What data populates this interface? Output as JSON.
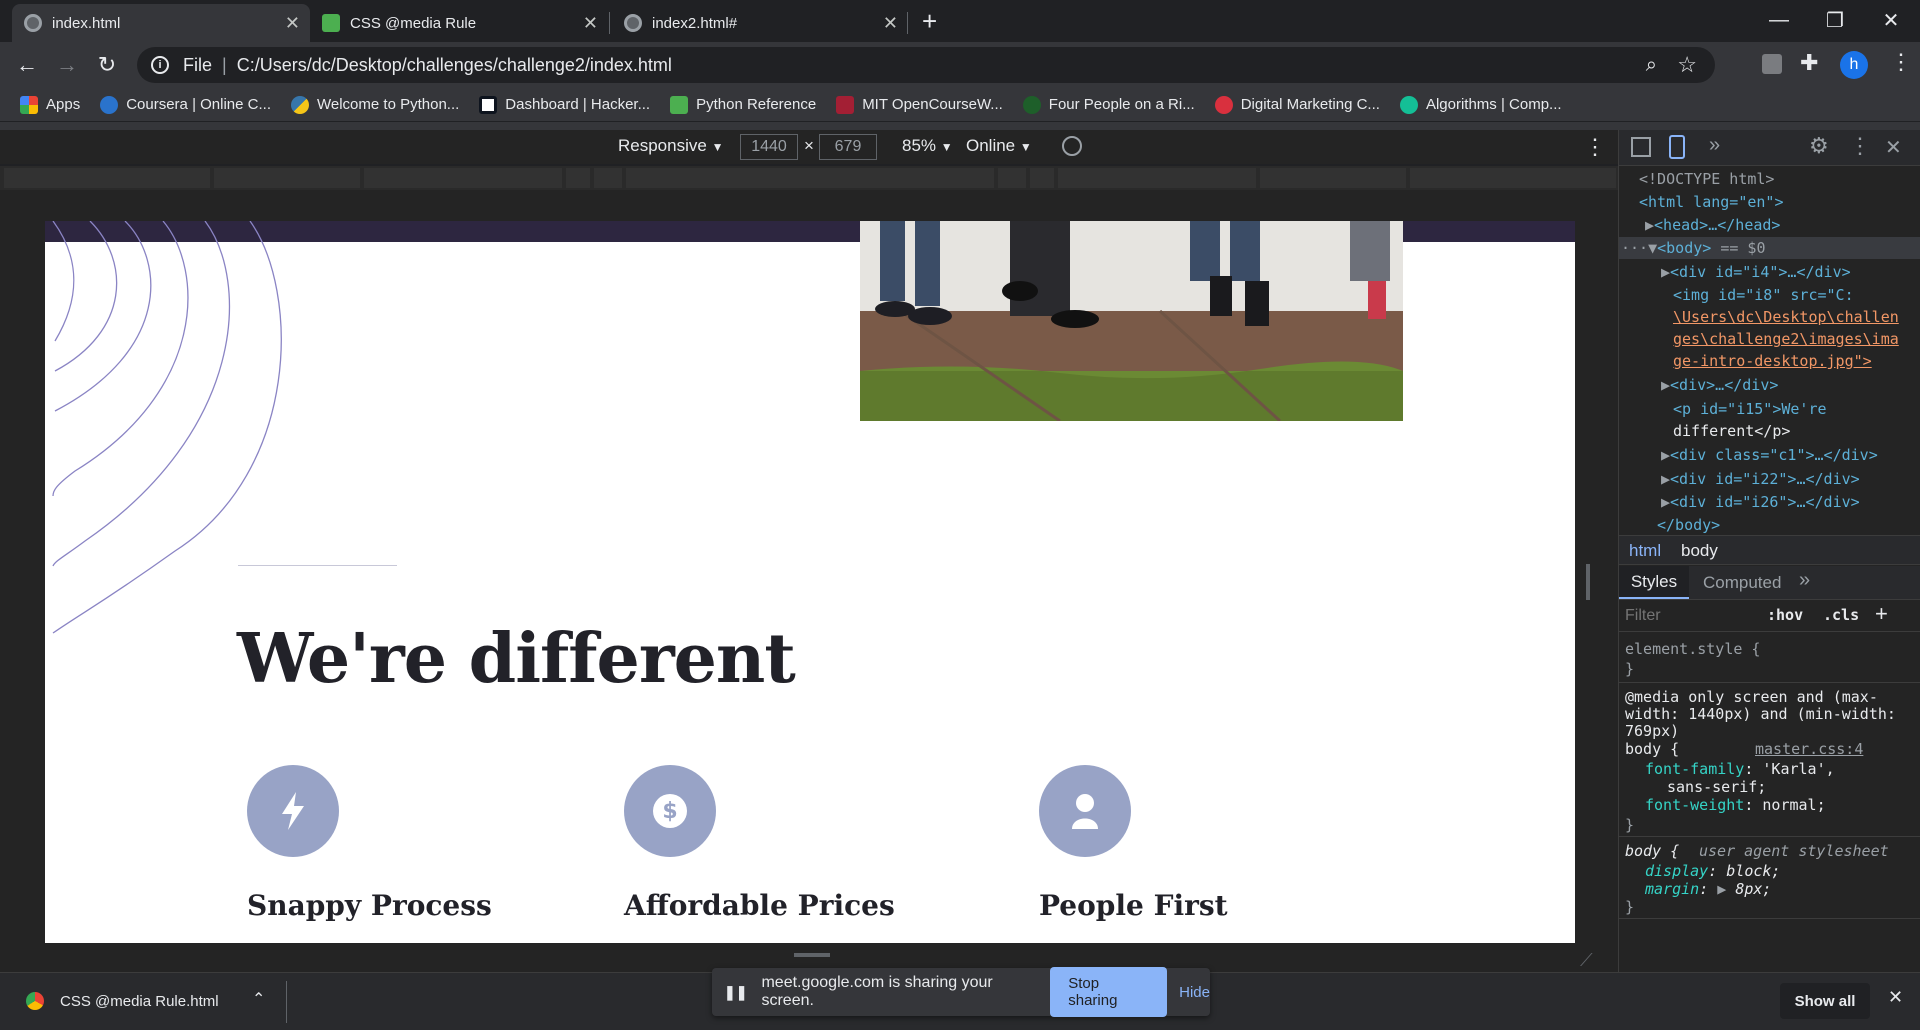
{
  "tabs": [
    {
      "title": "index.html",
      "active": true
    },
    {
      "title": "CSS @media Rule",
      "active": false
    },
    {
      "title": "index2.html#",
      "active": false
    }
  ],
  "window_controls": {
    "minimize": "—",
    "maximize": "❐",
    "close": "✕"
  },
  "toolbar": {
    "address_prefix": "File",
    "address": "C:/Users/dc/Desktop/challenges/challenge2/index.html",
    "profile_initial": "h"
  },
  "bookmarks": [
    {
      "label": "Apps",
      "color": "#ea4335"
    },
    {
      "label": "Coursera | Online C...",
      "color": "#2a73cc"
    },
    {
      "label": "Welcome to Python...",
      "color": "#f5c518"
    },
    {
      "label": "Dashboard | Hacker...",
      "color": "#0e141e"
    },
    {
      "label": "Python Reference",
      "color": "#4caf50"
    },
    {
      "label": "MIT OpenCourseW...",
      "color": "#a31f34"
    },
    {
      "label": "Four People on a Ri...",
      "color": "#1e5f2a"
    },
    {
      "label": "Digital Marketing C...",
      "color": "#d9303e"
    },
    {
      "label": "Algorithms | Comp...",
      "color": "#14bf96"
    }
  ],
  "device_toolbar": {
    "mode": "Responsive",
    "width": "1440",
    "times": "×",
    "height": "679",
    "zoom": "85%",
    "network": "Online"
  },
  "page": {
    "heading": "We're different",
    "features": [
      {
        "title": "Snappy Process",
        "icon": "lightning-icon"
      },
      {
        "title": "Affordable Prices",
        "icon": "dollar-icon"
      },
      {
        "title": "People First",
        "icon": "person-icon"
      }
    ]
  },
  "devtools": {
    "elements": {
      "doctype": "<!DOCTYPE html>",
      "html_open": "<html lang=\"en\">",
      "head": "<head>…</head>",
      "body_open": "<body>",
      "body_marker": " == $0",
      "div_i4": "<div id=\"i4\">…</div>",
      "img_line1": "<img id=\"i8\" src=\"C:",
      "img_line2": "\\Users\\dc\\Desktop\\challen",
      "img_line3": "ges\\challenge2\\images\\ima",
      "img_line4": "ge-intro-desktop.jpg\">",
      "div_plain": "<div>…</div>",
      "p_line1": "<p id=\"i15\">We're",
      "p_line2": "different</p>",
      "div_c1": "<div class=\"c1\">…</div>",
      "div_i22": "<div id=\"i22\">…</div>",
      "div_i26": "<div id=\"i26\">…</div>",
      "body_close": "</body>"
    },
    "breadcrumb": [
      "html",
      "body"
    ],
    "style_tabs": [
      "Styles",
      "Computed"
    ],
    "filter_placeholder": "Filter",
    "hov": ":hov",
    "cls": ".cls",
    "element_style": "element.style {",
    "close_brace": "}",
    "media_line1": "@media only screen and (max-",
    "media_line2": "width: 1440px) and (min-width:",
    "media_line3": "769px)",
    "body_selector": "body {",
    "rule_source": "master.css:4",
    "font_family_prop": "font-family",
    "font_family_val": "'Karla',",
    "font_family_val2": "sans-serif;",
    "font_weight_prop": "font-weight",
    "font_weight_val": "normal;",
    "ua_comment": "user agent stylesheet",
    "display_prop": "display",
    "display_val": "block;",
    "margin_prop": "margin",
    "margin_val": "8px;"
  },
  "download": {
    "file": "CSS @media Rule.html",
    "show_all": "Show all"
  },
  "share": {
    "message": "meet.google.com is sharing your screen.",
    "stop": "Stop sharing",
    "hide": "Hide"
  }
}
